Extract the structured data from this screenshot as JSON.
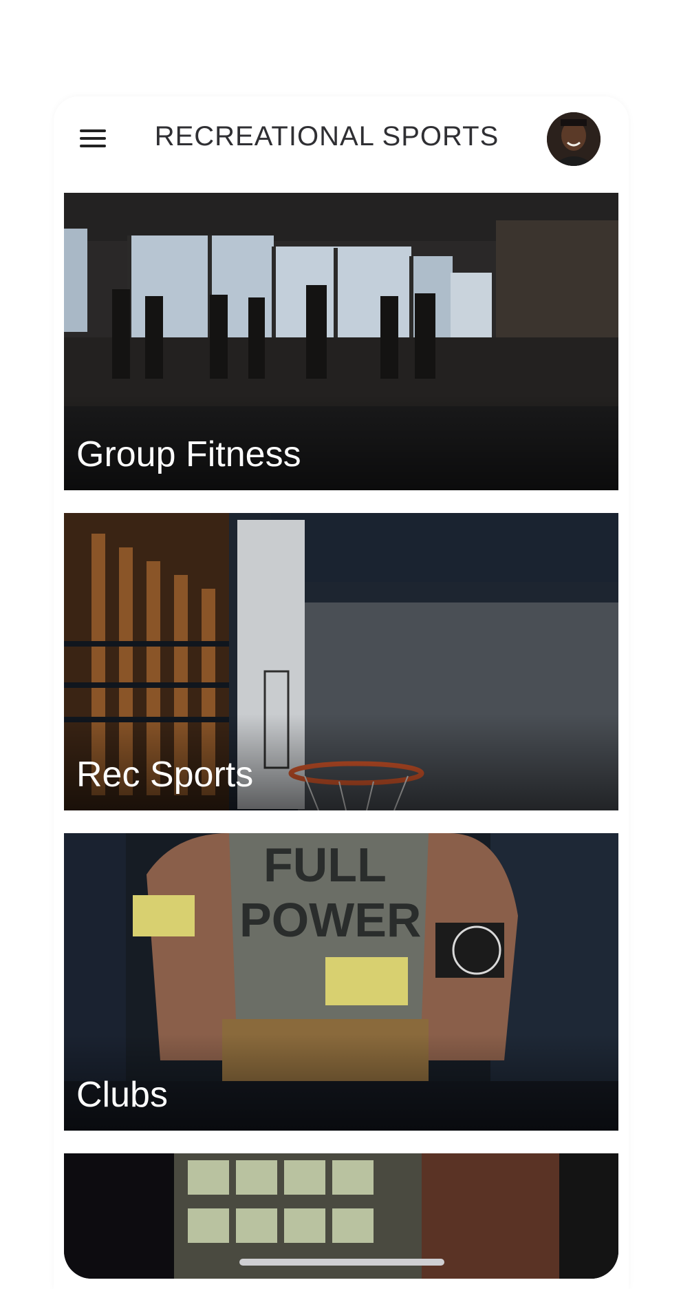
{
  "header": {
    "title": "RECREATIONAL SPORTS",
    "menu_icon": "hamburger-menu-icon",
    "avatar_icon": "user-avatar"
  },
  "cards": [
    {
      "label": "Group Fitness"
    },
    {
      "label": "Rec Sports"
    },
    {
      "label": "Clubs"
    },
    {
      "label": ""
    }
  ]
}
